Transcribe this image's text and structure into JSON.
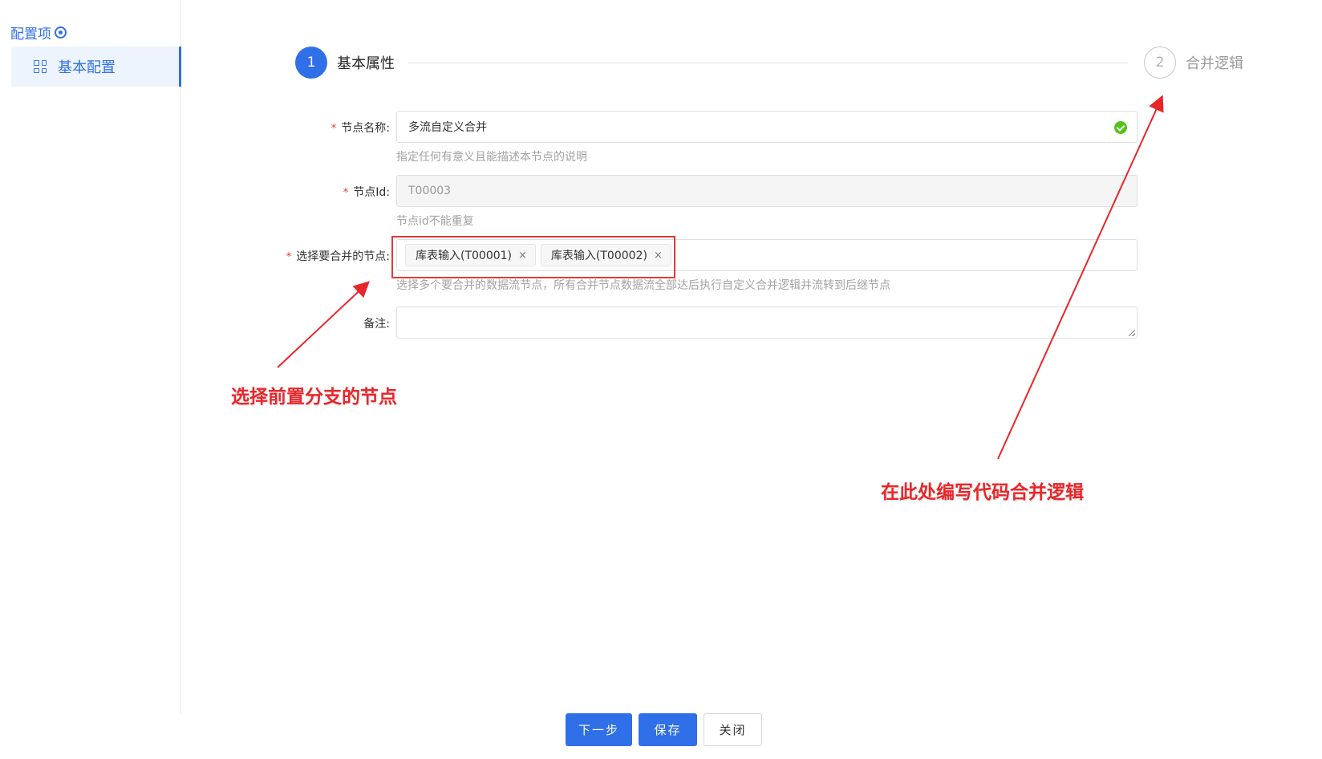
{
  "sidebar": {
    "header": "配置项",
    "items": [
      {
        "label": "基本配置"
      }
    ]
  },
  "steps": [
    {
      "number": "1",
      "label": "基本属性"
    },
    {
      "number": "2",
      "label": "合并逻辑"
    }
  ],
  "form": {
    "node_name": {
      "label": "节点名称:",
      "value": "多流自定义合并",
      "hint": "指定任何有意义且能描述本节点的说明"
    },
    "node_id": {
      "label": "节点Id:",
      "value": "T00003",
      "hint": "节点id不能重复"
    },
    "merge_nodes": {
      "label": "选择要合并的节点:",
      "tags": [
        "库表输入(T00001)",
        "库表输入(T00002)"
      ],
      "close_glyph": "×",
      "hint": "选择多个要合并的数据流节点，所有合并节点数据流全部达后执行自定义合并逻辑并流转到后继节点"
    },
    "remark": {
      "label": "备注:"
    }
  },
  "annotations": {
    "left": "选择前置分支的节点",
    "right": "在此处编写代码合并逻辑"
  },
  "buttons": {
    "next": "下一步",
    "save": "保存",
    "close": "关闭"
  },
  "colors": {
    "accent": "#2f6fe8",
    "annotation": "#e8262a",
    "success": "#52c41a"
  }
}
